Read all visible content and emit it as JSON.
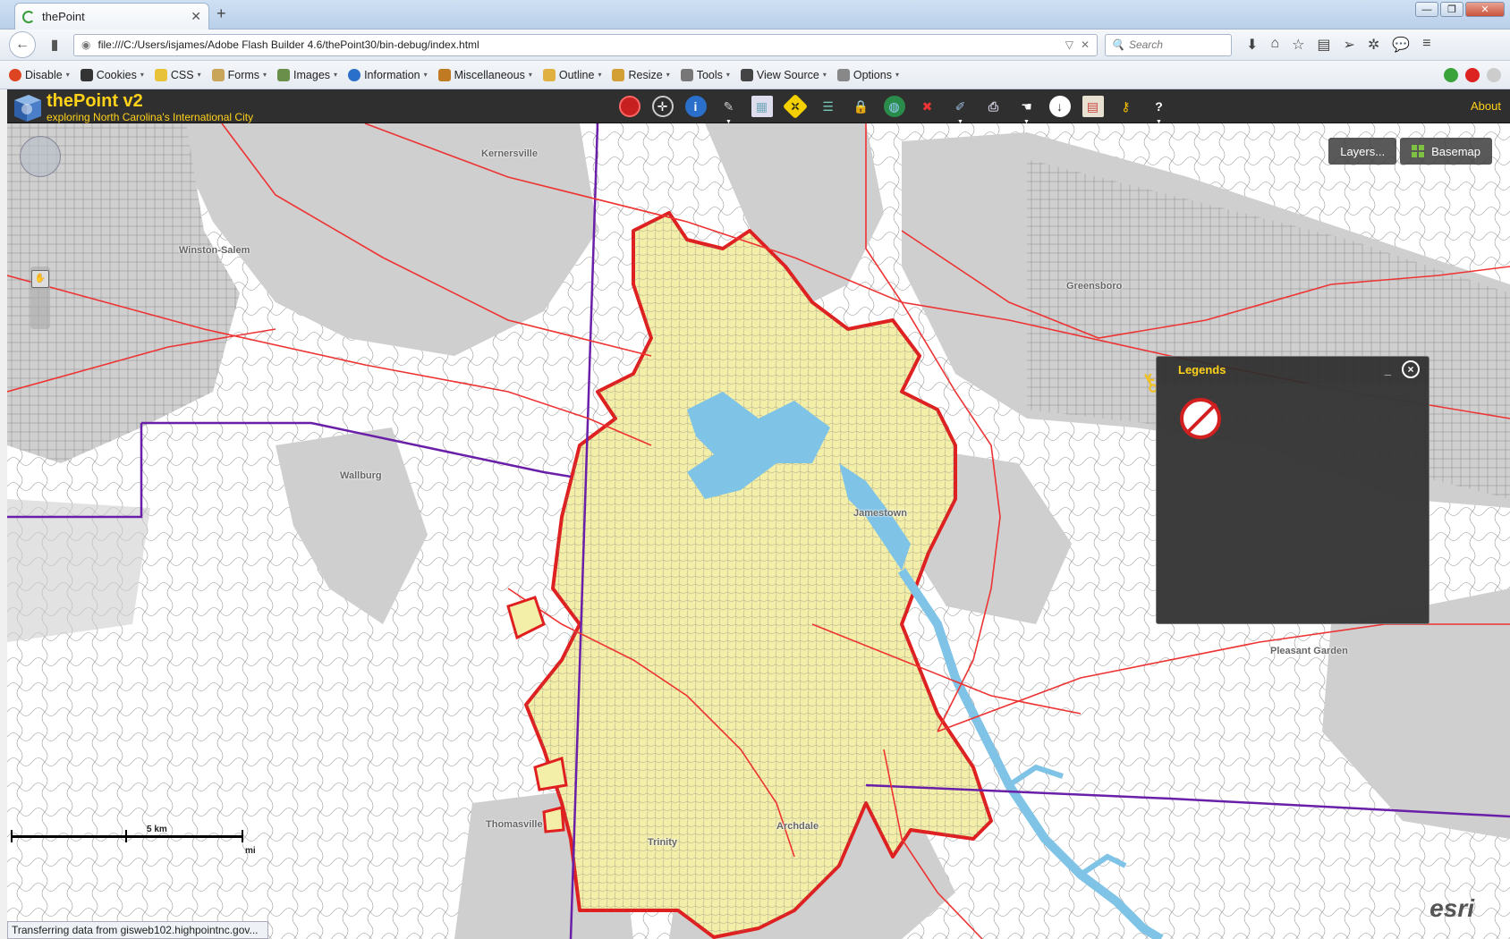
{
  "browser": {
    "tab_title": "thePoint",
    "url": "file:///C:/Users/isjames/Adobe Flash Builder 4.6/thePoint30/bin-debug/index.html",
    "search_placeholder": "Search"
  },
  "webdev_toolbar": {
    "items": [
      "Disable",
      "Cookies",
      "CSS",
      "Forms",
      "Images",
      "Information",
      "Miscellaneous",
      "Outline",
      "Resize",
      "Tools",
      "View Source",
      "Options"
    ]
  },
  "app": {
    "title": "thePoint v2",
    "subtitle": "exploring North Carolina's International City",
    "about_label": "About"
  },
  "map": {
    "layers_label": "Layers...",
    "basemap_label": "Basemap",
    "places": [
      {
        "name": "Kernersville"
      },
      {
        "name": "Winston-Salem"
      },
      {
        "name": "Greensboro"
      },
      {
        "name": "Wallburg"
      },
      {
        "name": "Jamestown"
      },
      {
        "name": "Pleasant Garden"
      },
      {
        "name": "Thomasville"
      },
      {
        "name": "Trinity"
      },
      {
        "name": "Archdale"
      }
    ],
    "scale_km": "5 km",
    "scale_mi": "mi",
    "attribution": "esri"
  },
  "legend": {
    "title": "Legends",
    "minimize": "_",
    "close": "×"
  },
  "status": {
    "text": "Transferring data from gisweb102.highpointnc.gov..."
  }
}
